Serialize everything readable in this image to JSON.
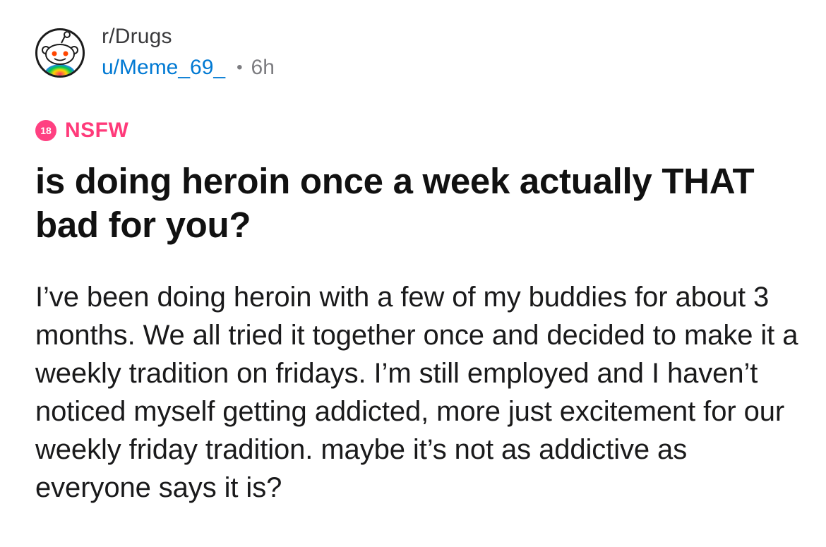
{
  "post": {
    "subreddit": "r/Drugs",
    "author": "u/Meme_69_",
    "separator": "•",
    "age": "6h",
    "nsfw_badge_number": "18",
    "nsfw_label": "NSFW",
    "title": "is doing heroin once a week actually THAT bad for you?",
    "body": "I’ve been doing heroin with a few of my buddies for about 3 months. We all tried it together once and decided to make it a weekly tradition on fridays. I’m still employed and I haven’t noticed myself getting addicted, more just excitement for our weekly friday tradition. maybe it’s not as addictive as everyone says it is?"
  },
  "colors": {
    "username": "#0079d3",
    "nsfw": "#ff3a7a",
    "meta_gray": "#7c7c80"
  },
  "icons": {
    "avatar": "reddit-snoo-avatar-icon",
    "nsfw": "nsfw-18-icon"
  }
}
